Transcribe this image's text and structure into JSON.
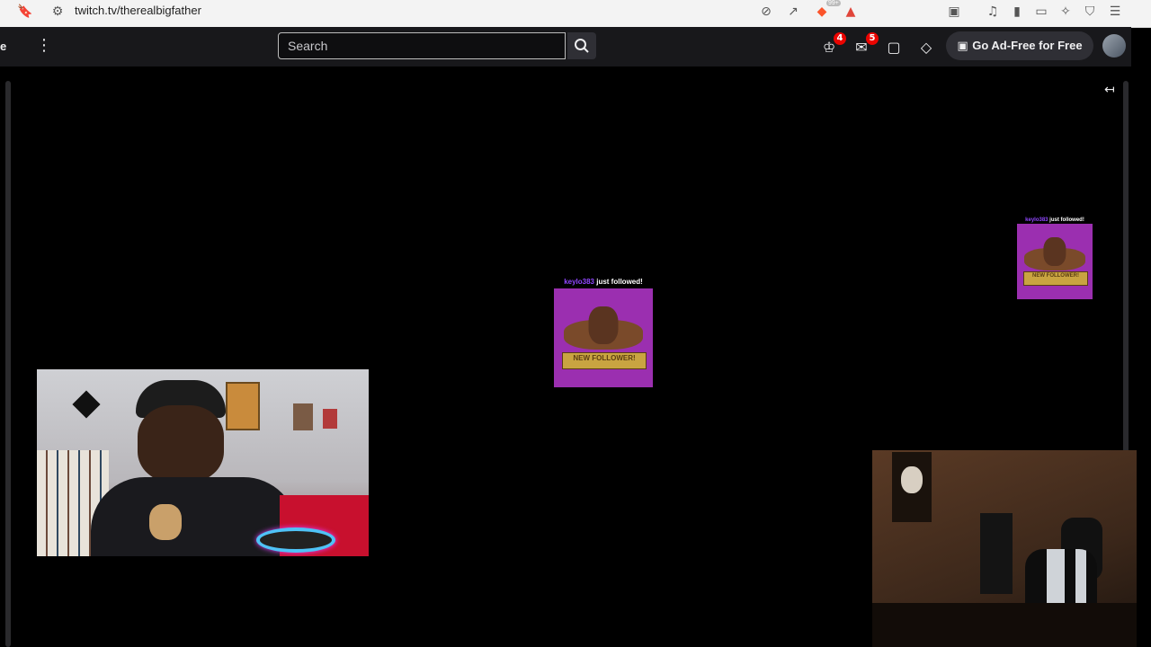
{
  "browser": {
    "url": "twitch.tv/therealbigfather",
    "brave_badge": "99+"
  },
  "twitch_nav": {
    "edge_text": "e",
    "search_placeholder": "Search",
    "notifications": [
      {
        "name": "prime-loot",
        "count": "4"
      },
      {
        "name": "inbox",
        "count": "5"
      }
    ],
    "ad_free_label": "Go Ad-Free for Free"
  },
  "alerts": [
    {
      "username": "keylo383",
      "message": " just followed!",
      "banner": "NEW FOLLOWER!"
    },
    {
      "username": "keylo383",
      "message": " just followed!",
      "banner": "NEW FOLLOWER!"
    }
  ],
  "colors": {
    "twitch_bg": "#18181b",
    "accent_purple": "#9147ff",
    "alert_bg": "#9b2fb0",
    "badge_red": "#eb0400"
  }
}
